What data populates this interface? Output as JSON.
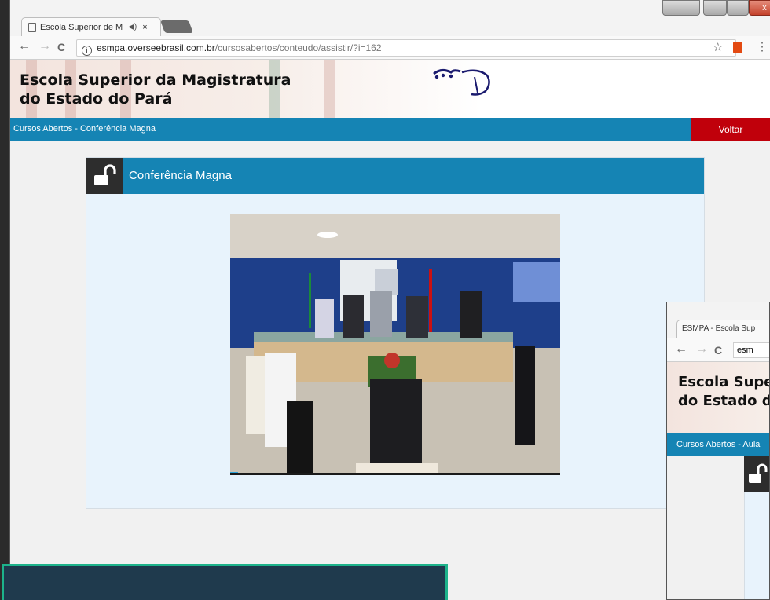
{
  "browser": {
    "tab_title": "Escola Superior de M",
    "url_domain": "esmpa.overseebrasil.com.br",
    "url_path": "/cursosabertos/conteudo/assistir/?i=162",
    "info_glyph": "i",
    "back_glyph": "←",
    "forward_glyph": "→",
    "reload_glyph": "C",
    "star_glyph": "☆",
    "menu_glyph": "⋮",
    "mute_glyph": "◀)",
    "close_glyph": "×"
  },
  "site": {
    "title_line1": "Escola Superior da Magistratura",
    "title_line2": "do Estado do Pará"
  },
  "navbar": {
    "breadcrumb": "Cursos Abertos - Conferência Magna",
    "back_button": "Voltar"
  },
  "panel": {
    "title": "Conferência Magna"
  },
  "window_controls": {
    "close_glyph": "x"
  },
  "second_window": {
    "tab_title": "ESMPA - Escola Sup",
    "url": "esm",
    "title_line1": "Escola Supe",
    "title_line2": "do Estado d",
    "breadcrumb": "Cursos Abertos - Aula"
  },
  "colors": {
    "nav_blue": "#1584b4",
    "back_red": "#c0000b",
    "panel_bg": "#e8f3fc",
    "overlay_border": "#1db38b"
  }
}
